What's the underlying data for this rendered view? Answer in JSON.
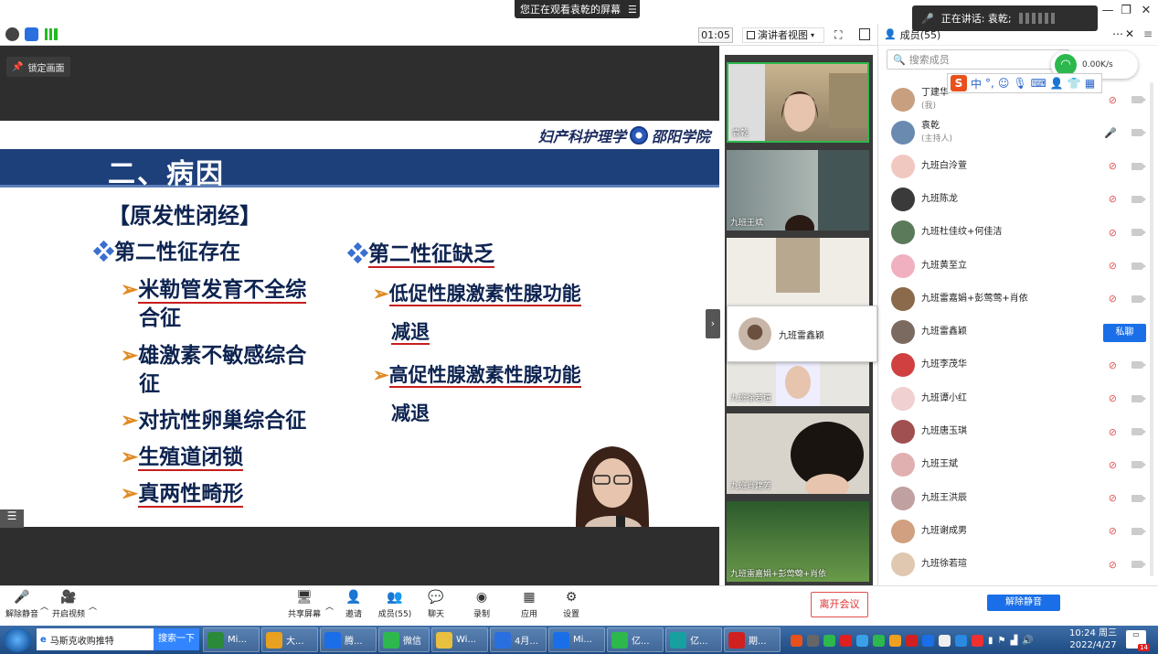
{
  "top": {
    "share_banner": "您正在观看袁乾的屏幕",
    "speaking": "正在讲话: 袁乾;"
  },
  "toolbar": {
    "timer": "01:05",
    "view_mode": "演讲者视图"
  },
  "main": {
    "lock_screen": "锁定画面"
  },
  "slide": {
    "school": "妇产科护理学",
    "school_logo_text": "邵阳学院",
    "title": "二、病因",
    "section": "【原发性闭经】",
    "left_heading": "第二性征存在",
    "left_items": [
      "米勒管发育不全综",
      "合征",
      "雄激素不敏感综合",
      "征",
      "对抗性卵巢综合征",
      "生殖道闭锁",
      "真两性畸形"
    ],
    "right_heading": "第二性征缺乏",
    "right_items": [
      "低促性腺激素性腺功能",
      "减退",
      "高促性腺激素性腺功能",
      "减退"
    ]
  },
  "video_strip": {
    "tiles": [
      {
        "name": "袁乾"
      },
      {
        "name": "九班王斌"
      },
      {
        "name": "九班徐若瑄"
      },
      {
        "name": "九班肖建芳"
      },
      {
        "name": "九班雷嘉娟+彭莺莺+肖依"
      }
    ],
    "hover_card_name": "九班雷鑫颖"
  },
  "members": {
    "title": "成员(55)",
    "search_placeholder": "搜索成员",
    "net_speed": "0.00K/s",
    "ime_label": "中",
    "list": [
      {
        "name": "丁建华",
        "sub": "(我)"
      },
      {
        "name": "袁乾",
        "sub": "(主持人)"
      },
      {
        "name": "九班白泠萱",
        "sub": ""
      },
      {
        "name": "九班陈龙",
        "sub": ""
      },
      {
        "name": "九班杜佳纹+何佳洁",
        "sub": ""
      },
      {
        "name": "九班黄至立",
        "sub": ""
      },
      {
        "name": "九班雷嘉娟+彭莺莺+肖依",
        "sub": ""
      },
      {
        "name": "九班雷鑫颖",
        "sub": ""
      },
      {
        "name": "九班李茂华",
        "sub": ""
      },
      {
        "name": "九班谭小红",
        "sub": ""
      },
      {
        "name": "九班唐玉琪",
        "sub": ""
      },
      {
        "name": "九班王斌",
        "sub": ""
      },
      {
        "name": "九班王洪辰",
        "sub": ""
      },
      {
        "name": "九班谢成男",
        "sub": ""
      },
      {
        "name": "九班徐若瑄",
        "sub": ""
      }
    ],
    "private_chat": "私聊",
    "unmute_all": "解除静音"
  },
  "bottombar": {
    "mute": "解除静音",
    "video": "开启视频",
    "share": "共享屏幕",
    "invite": "邀请",
    "members": "成员(55)",
    "chat": "聊天",
    "record": "录制",
    "apps": "应用",
    "settings": "设置",
    "leave": "离开会议"
  },
  "taskbar": {
    "search_text": "马斯克收购推特",
    "search_btn": "搜索一下",
    "tasks": [
      "Mi...",
      "大...",
      "腾...",
      "微信",
      "Wi...",
      "4月...",
      "Mi...",
      "亿...",
      "亿...",
      "期..."
    ],
    "clock_time": "10:24 周三",
    "clock_date": "2022/4/27",
    "notif_count": "14"
  }
}
